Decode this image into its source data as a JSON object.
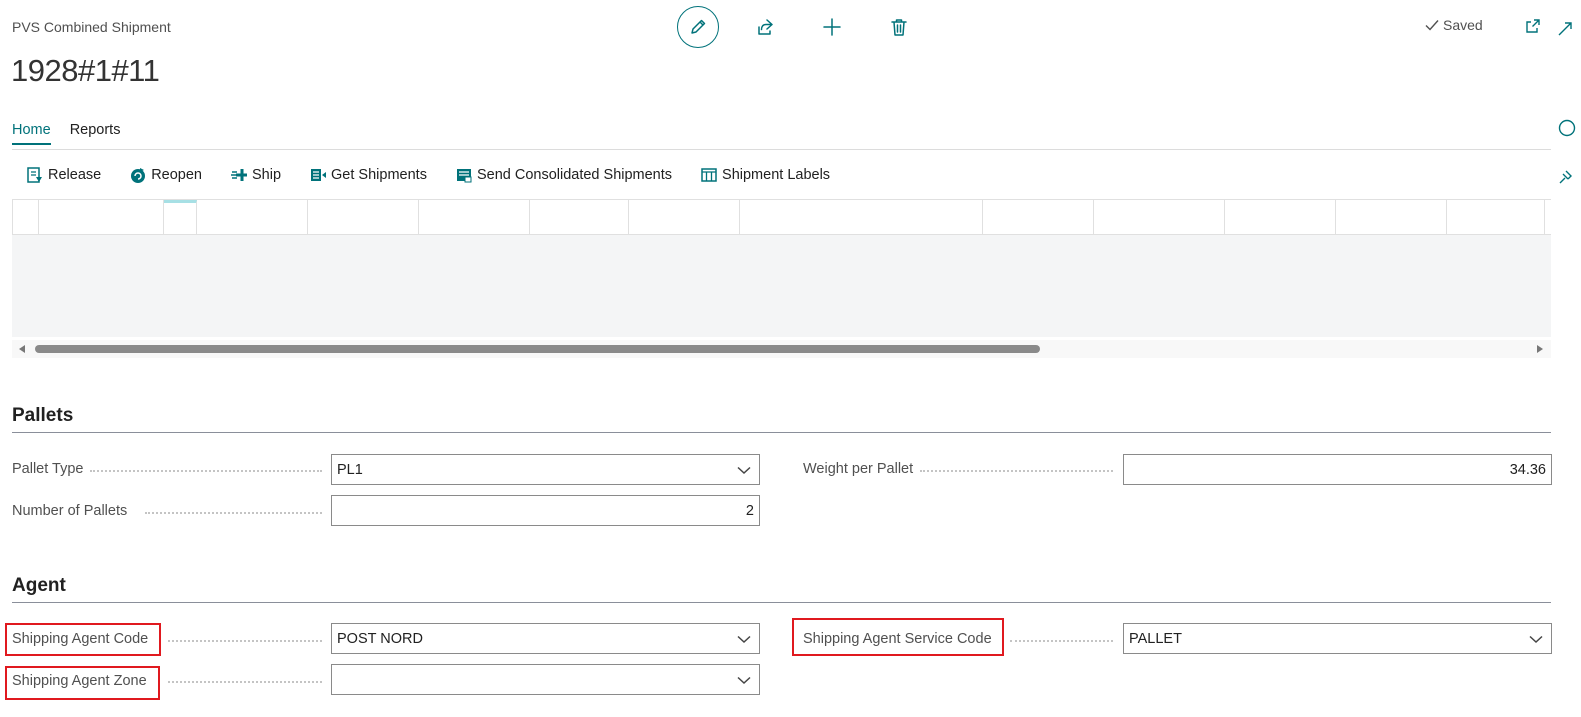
{
  "header": {
    "caption": "PVS Combined Shipment",
    "title": "1928#1#11",
    "saved_label": "Saved"
  },
  "actions": [
    "edit-icon",
    "share-icon",
    "add-icon",
    "delete-icon"
  ],
  "tabs": [
    {
      "label": "Home",
      "active": true
    },
    {
      "label": "Reports",
      "active": false
    }
  ],
  "toolbar": {
    "release": "Release",
    "reopen": "Reopen",
    "ship": "Ship",
    "get_shipments": "Get Shipments",
    "send_consolidated": "Send Consolidated Shipments",
    "shipment_labels": "Shipment Labels"
  },
  "pallets": {
    "title": "Pallets",
    "pallet_type_label": "Pallet Type",
    "pallet_type_value": "PL1",
    "number_label": "Number of Pallets",
    "number_value": "2",
    "weight_label": "Weight per Pallet",
    "weight_value": "34.36"
  },
  "agent": {
    "title": "Agent",
    "code_label": "Shipping Agent Code",
    "code_value": "POST NORD",
    "zone_label": "Shipping Agent Zone",
    "zone_value": "",
    "service_label": "Shipping Agent Service Code",
    "service_value": "PALLET"
  },
  "colors": {
    "accent": "#00727a",
    "highlight": "#e0191f"
  }
}
